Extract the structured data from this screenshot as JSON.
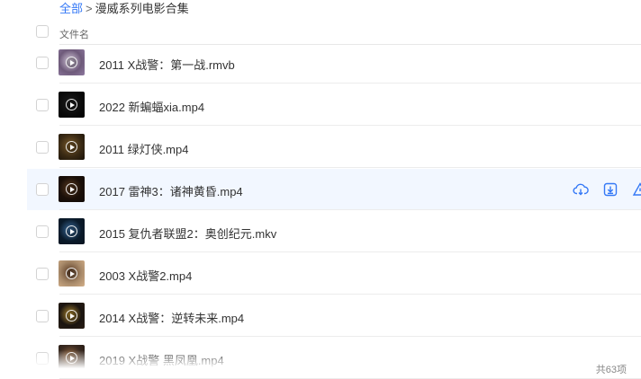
{
  "breadcrumb": {
    "root": "全部",
    "separator": ">",
    "current": "漫威系列电影合集"
  },
  "table_header": {
    "name_column": "文件名"
  },
  "files": [
    {
      "name": "2011 X战警：第一战.rmvb",
      "thumb_colors": [
        "#6e5a7a",
        "#d2c7d8",
        "#8f7aa0"
      ]
    },
    {
      "name": "2022 新蝙蝠xia.mp4",
      "thumb_colors": [
        "#0b0b0b",
        "#1e1e1e",
        "#000000"
      ]
    },
    {
      "name": "2011 绿灯侠.mp4",
      "thumb_colors": [
        "#3a2a14",
        "#7a5a2a",
        "#1a1208"
      ]
    },
    {
      "name": "2017 雷神3：诸神黄昏.mp4",
      "thumb_colors": [
        "#1a0f08",
        "#5a3a20",
        "#120a06"
      ]
    },
    {
      "name": "2015 复仇者联盟2：奥创纪元.mkv",
      "thumb_colors": [
        "#0a1a2a",
        "#3a6a9a",
        "#081420"
      ]
    },
    {
      "name": "2003 X战警2.mp4",
      "thumb_colors": [
        "#a88a6a",
        "#5a3a24",
        "#d4b08a"
      ]
    },
    {
      "name": "2014 X战警：逆转未来.mp4",
      "thumb_colors": [
        "#1a1410",
        "#b08a30",
        "#2a1e14"
      ]
    },
    {
      "name": "2019 X战警 黑凤凰.mp4",
      "thumb_colors": [
        "#3a2a20",
        "#9a6a40",
        "#201610"
      ]
    }
  ],
  "hovered_index": 3,
  "footer": {
    "count": "共63项"
  },
  "colors": {
    "accent": "#3478f6",
    "hover_bg": "#f2f7ff"
  }
}
